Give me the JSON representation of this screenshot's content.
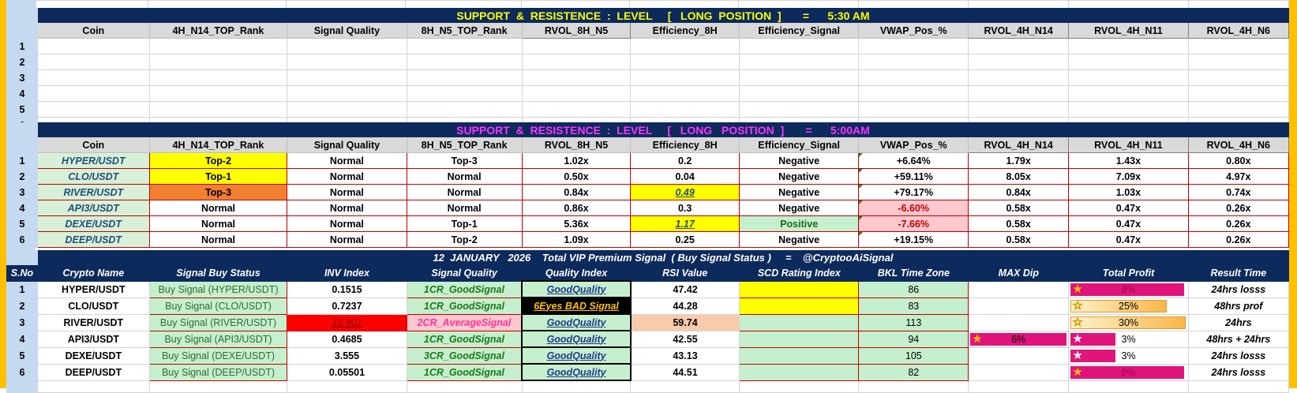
{
  "colors": {
    "frame": "#ffc000",
    "band": "#0d2a5c",
    "row_header": "#c5d9f1"
  },
  "section1": {
    "title": "SUPPORT  &  RESISTENCE  :  LEVEL     [   LONG  POSITION  ]       =      5:30 AM",
    "headers": [
      "Coin",
      "4H_N14_TOP_Rank",
      "Signal Quality",
      "8H_N5_TOP_Rank",
      "RVOL_8H_N5",
      "Efficiency_8H",
      "Efficiency_Signal",
      "VWAP_Pos_%",
      "RVOL_4H_N14",
      "RVOL_4H_N11",
      "RVOL_4H_N6"
    ],
    "row_numbers": [
      "1",
      "2",
      "3",
      "4",
      "5",
      "6"
    ]
  },
  "section2": {
    "title": "SUPPORT  &  RESISTENCE  :  LEVEL     [   LONG   POSITION  ]       =      5:00AM",
    "headers": [
      "Coin",
      "4H_N14_TOP_Rank",
      "Signal Quality",
      "8H_N5_TOP_Rank",
      "RVOL_8H_N5",
      "Efficiency_8H",
      "Efficiency_Signal",
      "VWAP_Pos_%",
      "RVOL_4H_N14",
      "RVOL_4H_N11",
      "RVOL_4H_N6"
    ],
    "rows": [
      {
        "n": "1",
        "coin": "HYPER/USDT",
        "rank4h": "Top-2",
        "sq": "Normal",
        "rank8h": "Top-3",
        "rvol8": "1.02x",
        "eff": "0.2",
        "effsig": "Negative",
        "vwap": "+6.64%",
        "r14": "1.79x",
        "r11": "1.43x",
        "r6": "0.80x"
      },
      {
        "n": "2",
        "coin": "CLO/USDT",
        "rank4h": "Top-1",
        "sq": "Normal",
        "rank8h": "Normal",
        "rvol8": "0.50x",
        "eff": "0.04",
        "effsig": "Negative",
        "vwap": "+59.11%",
        "r14": "8.05x",
        "r11": "7.09x",
        "r6": "4.97x"
      },
      {
        "n": "3",
        "coin": "RIVER/USDT",
        "rank4h": "Top-3",
        "sq": "Normal",
        "rank8h": "Normal",
        "rvol8": "0.84x",
        "eff": "0.49",
        "effsig": "Negative",
        "vwap": "+79.17%",
        "r14": "0.84x",
        "r11": "1.03x",
        "r6": "0.74x"
      },
      {
        "n": "4",
        "coin": "API3/USDT",
        "rank4h": "Normal",
        "sq": "Normal",
        "rank8h": "Normal",
        "rvol8": "0.86x",
        "eff": "0.3",
        "effsig": "Negative",
        "vwap": "-6.60%",
        "r14": "0.58x",
        "r11": "0.47x",
        "r6": "0.26x"
      },
      {
        "n": "5",
        "coin": "DEXE/USDT",
        "rank4h": "Normal",
        "sq": "Normal",
        "rank8h": "Top-1",
        "rvol8": "5.36x",
        "eff": "1.17",
        "effsig": "Positive",
        "vwap": "-7.66%",
        "r14": "0.58x",
        "r11": "0.47x",
        "r6": "0.26x"
      },
      {
        "n": "6",
        "coin": "DEEP/USDT",
        "rank4h": "Normal",
        "sq": "Normal",
        "rank8h": "Top-2",
        "rvol8": "1.09x",
        "eff": "0.25",
        "effsig": "Negative",
        "vwap": "+19.15%",
        "r14": "0.58x",
        "r11": "0.47x",
        "r6": "0.26x"
      }
    ]
  },
  "section3": {
    "title": "12  JANUARY   2026    Total VIP Premium Signal  ( Buy Signal Status )     =    @CryptooAiSignal",
    "headers": [
      "S.No",
      "Crypto Name",
      "Signal Buy Status",
      "INV  Index",
      "Signal Quality",
      "Quality Index",
      "RSI Value",
      "SCD  Rating Index",
      "BKL Time Zone",
      "MAX Dip",
      "Total Profit",
      "Result Time"
    ],
    "rows": [
      {
        "n": "1",
        "name": "HYPER/USDT",
        "status": "Buy Signal (HYPER/USDT)",
        "inv": "0.1515",
        "sq": "1CR_GoodSignal",
        "qi": "GoodQuality",
        "rsi": "47.42",
        "bkl": "86",
        "dip": "",
        "profit": "8%",
        "profit_frac": 0.5,
        "result": "24hrs losss"
      },
      {
        "n": "2",
        "name": "CLO/USDT",
        "status": "Buy Signal (CLO/USDT)",
        "inv": "0.7237",
        "sq": "1CR_GoodSignal",
        "qi": "6Eyes  BAD  Signal",
        "rsi": "44.28",
        "bkl": "83",
        "dip": "",
        "profit": "25%",
        "profit_frac": 0.38,
        "result": "48hrs prof"
      },
      {
        "n": "3",
        "name": "RIVER/USDT",
        "status": "Buy Signal (RIVER/USDT)",
        "inv": "16.801",
        "sq": "2CR_AverageSignal",
        "qi": "GoodQuality",
        "rsi": "59.74",
        "bkl": "113",
        "dip": "",
        "profit": "30%",
        "profit_frac": 0.45,
        "result": "24hrs"
      },
      {
        "n": "4",
        "name": "API3/USDT",
        "status": "Buy Signal (API3/USDT)",
        "inv": "0.4685",
        "sq": "1CR_GoodSignal",
        "qi": "GoodQuality",
        "rsi": "42.55",
        "bkl": "94",
        "dip": "6%",
        "dip_frac": 1.0,
        "profit": "3%",
        "profit_frac": 0.3,
        "result": "48hrs + 24hrs"
      },
      {
        "n": "5",
        "name": "DEXE/USDT",
        "status": "Buy Signal (DEXE/USDT)",
        "inv": "3.555",
        "sq": "3CR_GoodSignal",
        "qi": "GoodQuality",
        "rsi": "43.13",
        "bkl": "105",
        "dip": "",
        "profit": "3%",
        "profit_frac": 0.3,
        "result": "24hrs losss"
      },
      {
        "n": "6",
        "name": "DEEP/USDT",
        "status": "Buy Signal (DEEP/USDT)",
        "inv": "0.05501",
        "sq": "1CR_GoodSignal",
        "qi": "GoodQuality",
        "rsi": "44.51",
        "bkl": "82",
        "dip": "",
        "profit": "8%",
        "profit_frac": 0.5,
        "result": "24hrs losss"
      }
    ]
  }
}
